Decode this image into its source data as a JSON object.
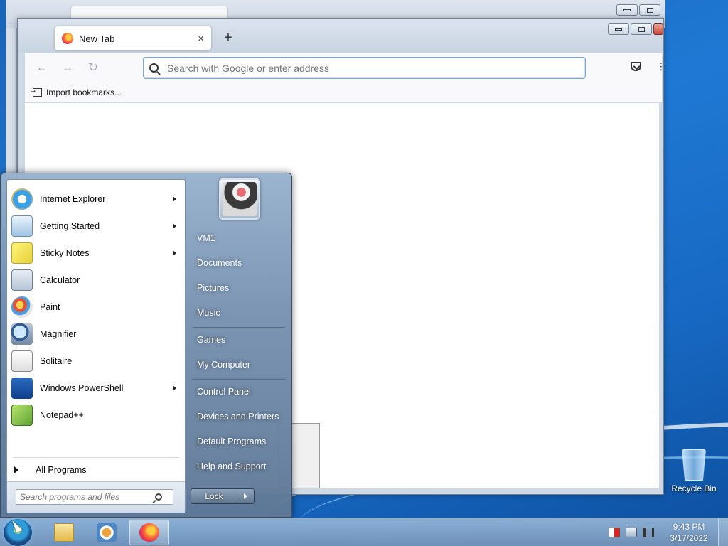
{
  "browser": {
    "tab_title": "New Tab",
    "tab_close": "×",
    "new_tab": "+",
    "url_placeholder": "Search with Google or enter address",
    "import_bookmarks": "Import bookmarks...",
    "nav": {
      "back": "←",
      "forward": "→",
      "reload": "↻",
      "menu": "⋮"
    }
  },
  "start_menu": {
    "programs": [
      {
        "label": "Internet Explorer",
        "icon": "internet-explorer-icon",
        "has_submenu": true
      },
      {
        "label": "Getting Started",
        "icon": "getting-started-icon",
        "has_submenu": true
      },
      {
        "label": "Sticky Notes",
        "icon": "sticky-notes-icon",
        "has_submenu": true
      },
      {
        "label": "Calculator",
        "icon": "calculator-icon",
        "has_submenu": false
      },
      {
        "label": "Paint",
        "icon": "paint-icon",
        "has_submenu": false
      },
      {
        "label": "Magnifier",
        "icon": "magnifier-icon",
        "has_submenu": false
      },
      {
        "label": "Solitaire",
        "icon": "solitaire-icon",
        "has_submenu": false
      },
      {
        "label": "Windows PowerShell",
        "icon": "powershell-icon",
        "has_submenu": true
      },
      {
        "label": "Notepad++",
        "icon": "notepad-plus-plus-icon",
        "has_submenu": false
      }
    ],
    "all_programs": "All Programs",
    "search_placeholder": "Search programs and files",
    "right_links": [
      "VM1",
      "Documents",
      "Pictures",
      "Music",
      "Games",
      "My Computer",
      "Control Panel",
      "Devices and Printers",
      "Default Programs",
      "Help and Support"
    ],
    "lock_label": "Lock"
  },
  "desktop": {
    "recycle_bin": "Recycle Bin"
  },
  "taskbar": {
    "time": "9:43 PM",
    "date": "3/17/2022"
  }
}
